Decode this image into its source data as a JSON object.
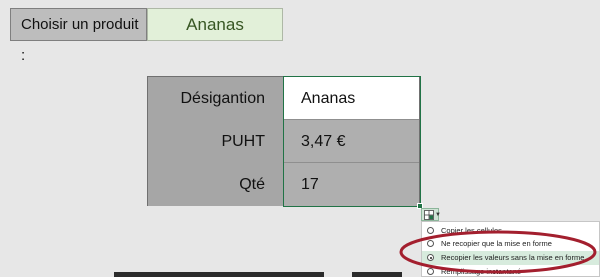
{
  "selector": {
    "label": "Choisir un produit :",
    "value": "Ananas"
  },
  "table": {
    "rows": [
      {
        "label": "Désigantion",
        "value": "Ananas"
      },
      {
        "label": "PUHT",
        "value": "3,47 €"
      },
      {
        "label": "Qté",
        "value": "17"
      }
    ]
  },
  "autofill_menu": {
    "items": [
      {
        "label": "Copier les cellules",
        "selected": false
      },
      {
        "label": "Ne recopier que la mise en forme",
        "selected": false
      },
      {
        "label": "Recopier les valeurs sans la mise en forme",
        "selected": true
      },
      {
        "label": "Remplissage instantané",
        "selected": false
      }
    ]
  },
  "colors": {
    "selected_value_bg": "#e2f0d9",
    "label_bg": "#a6a6a6",
    "accent_green": "#217346",
    "annotation_red": "#a31f2e"
  }
}
